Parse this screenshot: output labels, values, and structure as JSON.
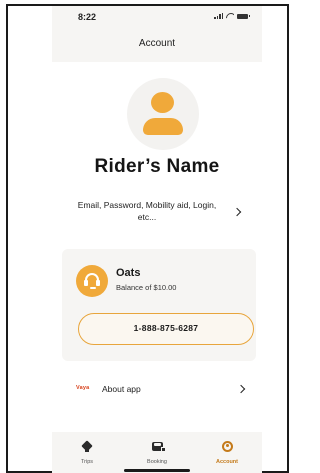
{
  "status_bar": {
    "time": "8:22",
    "icons": [
      "signal-icon",
      "wifi-icon",
      "battery-icon"
    ]
  },
  "header": {
    "title": "Account"
  },
  "profile": {
    "avatar_icon": "user-avatar-icon",
    "name": "Rider’s Name"
  },
  "settings": {
    "label": "Email, Password, Mobility aid, Login, etc...",
    "icon": "chevron-right-icon"
  },
  "provider": {
    "logo_icon": "headset-icon",
    "name": "Oats",
    "balance": "Balance of $10.00",
    "phone": "1-888-875-6287"
  },
  "about": {
    "logo_text": "Vaya",
    "label": "About app",
    "icon": "chevron-right-icon"
  },
  "tabs": [
    {
      "label": "Trips",
      "icon": "map-pin-icon",
      "active": false
    },
    {
      "label": "Booking",
      "icon": "car-booking-icon",
      "active": false
    },
    {
      "label": "Account",
      "icon": "account-icon",
      "active": true
    }
  ],
  "colors": {
    "accent": "#f0a93a",
    "active_tab": "#c47a1a",
    "card_bg": "#f6f5f3"
  }
}
